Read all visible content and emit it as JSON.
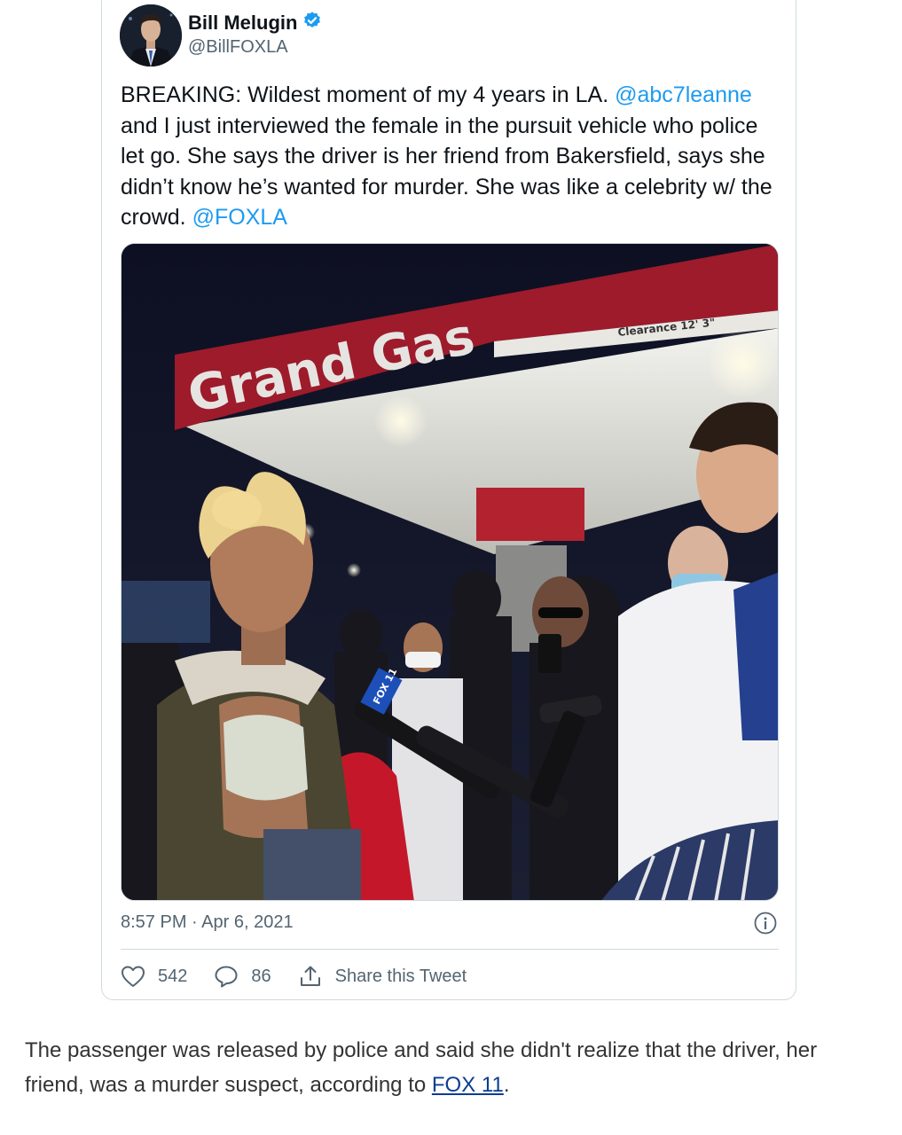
{
  "tweet": {
    "author_name": "Bill Melugin",
    "author_handle": "@BillFOXLA",
    "verified": true,
    "text_segments": [
      {
        "text": "BREAKING: Wildest moment of my 4 years in LA. ",
        "type": "plain"
      },
      {
        "text": "@abc7leanne",
        "type": "mention"
      },
      {
        "text": " and I just interviewed the female in the pursuit vehicle who police let go. She says the driver is her friend from Bakersfield, says she didn’t know he’s wanted for murder. She was like a celebrity w/ the crowd. ",
        "type": "plain"
      },
      {
        "text": "@FOXLA",
        "type": "mention"
      }
    ],
    "timestamp": "8:57 PM · Apr 6, 2021",
    "likes": "542",
    "replies": "86",
    "share_label": "Share this Tweet",
    "photo": {
      "sign_main": "Grand Gas",
      "sign_clearance": "Clearance 12' 3\"",
      "mic_flag": "FOX 11"
    }
  },
  "article": {
    "caption_before": "The passenger was released by police and said she didn't realize that the driver, her friend, was a murder suspect, according to ",
    "caption_link": "FOX 11",
    "caption_after": "."
  },
  "colors": {
    "link_blue": "#1d9bf0",
    "verified_blue": "#1d9bf0",
    "muted_text": "#536471",
    "border": "#cfd9de",
    "article_link": "#0b3d91"
  }
}
